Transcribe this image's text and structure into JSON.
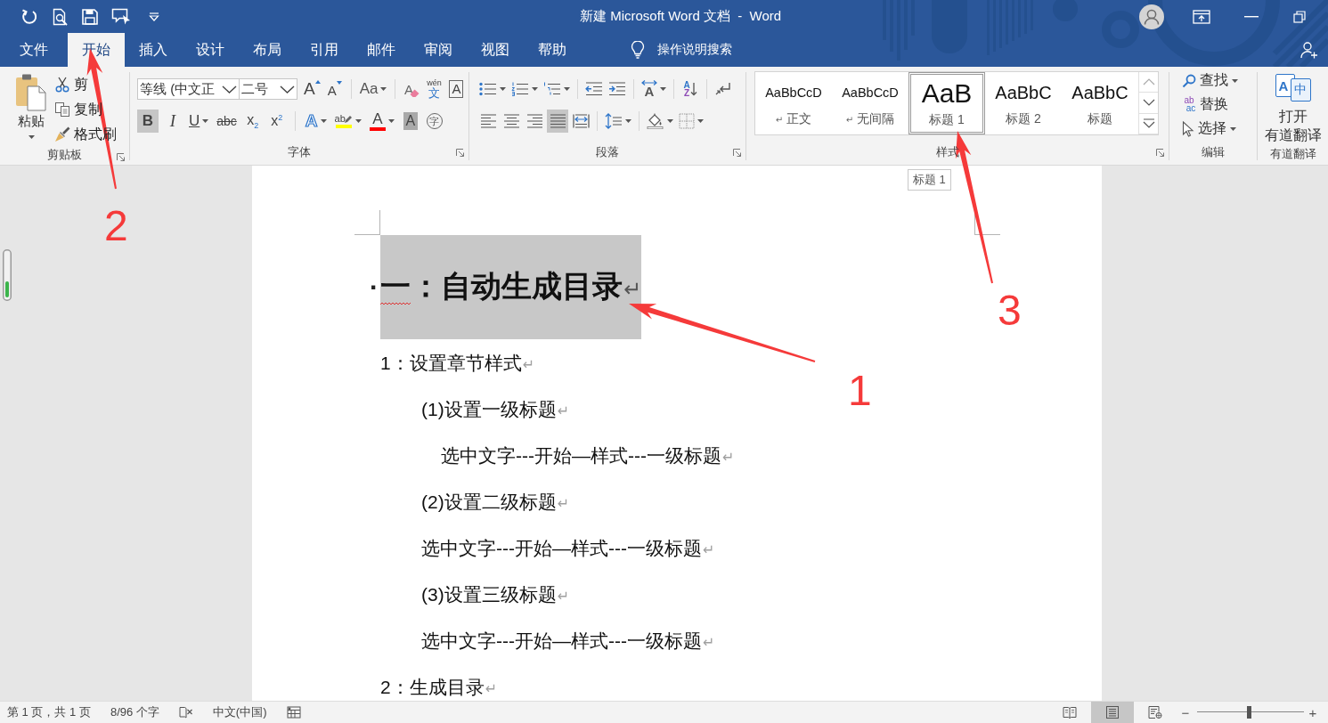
{
  "window": {
    "title": "新建 Microsoft Word 文档  -  Word"
  },
  "tabs": [
    {
      "label": "文件",
      "selected": false
    },
    {
      "label": "开始",
      "selected": true
    },
    {
      "label": "插入",
      "selected": false
    },
    {
      "label": "设计",
      "selected": false
    },
    {
      "label": "布局",
      "selected": false
    },
    {
      "label": "引用",
      "selected": false
    },
    {
      "label": "邮件",
      "selected": false
    },
    {
      "label": "审阅",
      "selected": false
    },
    {
      "label": "视图",
      "selected": false
    },
    {
      "label": "帮助",
      "selected": false
    }
  ],
  "tell_me": {
    "label": "操作说明搜索"
  },
  "ribbon": {
    "clipboard": {
      "label": "剪贴板",
      "paste": "粘贴",
      "commands": [
        {
          "kind": "cut",
          "label": "剪"
        },
        {
          "kind": "copy",
          "label": "复制"
        },
        {
          "kind": "format_painter",
          "label": "格式刷"
        }
      ]
    },
    "font": {
      "label": "字体",
      "font_name": "等线 (中文正",
      "font_size": "二号",
      "row_1": [
        {
          "kind": "grow",
          "glyph": "A"
        },
        {
          "kind": "shrink",
          "glyph": "A"
        },
        {
          "kind": "change_case",
          "glyph": "Aa"
        },
        {
          "kind": "clear_format",
          "glyph": "A"
        },
        {
          "kind": "phonetic",
          "glyph": "wén",
          "glyph_2": "文"
        },
        {
          "kind": "char_border",
          "glyph": "A"
        }
      ],
      "row_2": [
        {
          "kind": "bold",
          "glyph": "B",
          "pressed": true
        },
        {
          "kind": "italic",
          "glyph": "I",
          "pressed": false
        },
        {
          "kind": "underline",
          "glyph": "U",
          "pressed": false
        },
        {
          "kind": "strikethrough",
          "glyph": "abc",
          "pressed": false
        },
        {
          "kind": "subscript",
          "glyph": "x$_{2}$",
          "pressed": false
        },
        {
          "kind": "superscript",
          "glyph": "x$^{2}$",
          "pressed": false
        },
        {
          "kind": "text_effect",
          "glyph": "A",
          "pressed": false
        },
        {
          "kind": "highlight",
          "glyph": "ab",
          "color": "#ffff00",
          "pressed": false
        },
        {
          "kind": "font_color",
          "glyph": "A",
          "color": "#ff0000",
          "pressed": false
        },
        {
          "kind": "char_shading",
          "glyph": "A",
          "pressed": false
        },
        {
          "kind": "enclose",
          "glyph": "字",
          "pressed": false
        }
      ]
    },
    "paragraph": {
      "label": "段落",
      "row_1": [
        {
          "kind": "bullets"
        },
        {
          "kind": "numbering"
        },
        {
          "kind": "multilevel"
        },
        {
          "kind": "decrease_indent"
        },
        {
          "kind": "increase_indent"
        },
        {
          "kind": "asian_layout",
          "glyph": "A"
        },
        {
          "kind": "sort",
          "glyph": "A",
          "glyph_2": "Z"
        },
        {
          "kind": "show_marks"
        }
      ],
      "row_2": [
        {
          "kind": "align_left",
          "pressed": false
        },
        {
          "kind": "align_center",
          "pressed": false
        },
        {
          "kind": "align_right",
          "pressed": false
        },
        {
          "kind": "justify",
          "pressed": true
        },
        {
          "kind": "distribute",
          "pressed": false
        },
        {
          "kind": "line_spacing",
          "pressed": false
        },
        {
          "kind": "shading",
          "pressed": false
        },
        {
          "kind": "borders",
          "pressed": false
        }
      ]
    },
    "styles": {
      "label": "样式",
      "items": [
        {
          "kind": "normal",
          "preview": "AaBbCcD",
          "mark": "↵",
          "name": "正文",
          "selected": false
        },
        {
          "kind": "no_spacing",
          "preview": "AaBbCcD",
          "mark": "↵",
          "name": "无间隔",
          "selected": false
        },
        {
          "kind": "heading_1",
          "preview": "AaB",
          "name": "标题 1",
          "selected": true
        },
        {
          "kind": "heading_2",
          "preview": "AaBbC",
          "name": "标题 2",
          "selected": false
        },
        {
          "kind": "title",
          "preview": "AaBbC",
          "name": "标题",
          "selected": false
        }
      ]
    },
    "editing": {
      "label": "编辑",
      "commands": [
        {
          "kind": "find",
          "label": "查找",
          "dropdown": true
        },
        {
          "kind": "replace",
          "label": "替换",
          "glyph": "ab",
          "glyph_2": "ac",
          "dropdown": false
        },
        {
          "kind": "select",
          "label": "选择",
          "dropdown": true
        }
      ]
    },
    "youdao": {
      "label": "有道翻译",
      "button": [
        "打开",
        "有道翻译"
      ],
      "glyph": "A",
      "glyph_2": "中"
    }
  },
  "tooltip": {
    "text": "标题 1"
  },
  "document": {
    "heading": {
      "bullet": "·",
      "text": "一：自动生成目录",
      "mark": "↵",
      "selected": true,
      "spelling_error": true
    },
    "paragraphs": [
      {
        "text": "1：设置章节样式",
        "mark": "↵",
        "children": [
          {
            "text": "(1)设置一级标题",
            "mark": "↵",
            "children": [
              {
                "text": "选中文字---开始—样式---一级标题",
                "mark": "↵"
              }
            ]
          },
          {
            "text": "(2)设置二级标题",
            "mark": "↵"
          },
          {
            "text": "选中文字---开始—样式---一级标题",
            "mark": "↵"
          },
          {
            "text": "(3)设置三级标题",
            "mark": "↵"
          },
          {
            "text": "选中文字---开始—样式---一级标题",
            "mark": "↵"
          }
        ]
      },
      {
        "text": "2：生成目录",
        "mark": "↵"
      }
    ]
  },
  "status_bar": {
    "page": "第 1 页，共 1 页",
    "words": "8/96 个字",
    "language": "中文(中国)",
    "views": [
      {
        "kind": "read",
        "selected": false
      },
      {
        "kind": "print",
        "selected": true
      },
      {
        "kind": "web",
        "selected": false
      }
    ],
    "zoom_out": "−",
    "zoom": {
      "level": 0.48
    },
    "zoom_in": "+"
  },
  "annotations": [
    {
      "number": "1"
    },
    {
      "number": "2"
    },
    {
      "number": "3"
    }
  ]
}
